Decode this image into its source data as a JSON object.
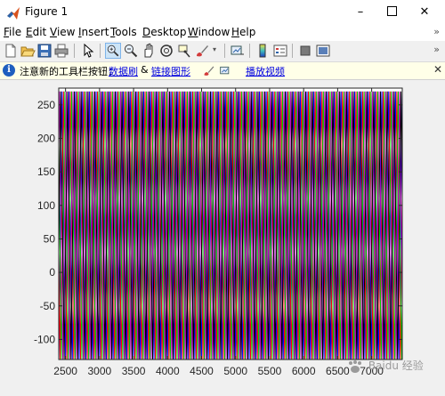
{
  "window": {
    "title": "Figure 1",
    "minimize": "–",
    "close": "✕"
  },
  "menubar": {
    "items": [
      {
        "label": "File",
        "underline": "F",
        "rest": "ile"
      },
      {
        "label": "Edit",
        "underline": "E",
        "rest": "dit"
      },
      {
        "label": "View",
        "underline": "V",
        "rest": "iew"
      },
      {
        "label": "Insert",
        "underline": "I",
        "rest": "nsert"
      },
      {
        "label": "Tools",
        "underline": "T",
        "rest": "ools"
      },
      {
        "label": "Desktop",
        "underline": "D",
        "rest": "esktop"
      },
      {
        "label": "Window",
        "underline": "W",
        "rest": "indow"
      },
      {
        "label": "Help",
        "underline": "H",
        "rest": "elp"
      }
    ],
    "overflow": "»"
  },
  "toolbar": {
    "icons": [
      "new-figure-icon",
      "open-file-icon",
      "save-icon",
      "print-icon",
      "edit-plot-arrow-icon",
      "zoom-in-icon",
      "zoom-out-icon",
      "pan-hand-icon",
      "rotate-3d-icon",
      "data-cursor-icon",
      "brush-icon",
      "link-plot-icon",
      "colorbar-icon",
      "legend-icon",
      "hide-plot-tools-icon",
      "show-plot-tools-icon"
    ],
    "overflow": "»"
  },
  "infobar": {
    "message": "注意新的工具栏按钮：",
    "link1": "数据刷",
    "amp": "&",
    "link2": "链接图形",
    "link3": "播放视频",
    "close": "✕"
  },
  "watermark": {
    "text": "Baidu 经验"
  },
  "chart_data": {
    "type": "line",
    "title": "",
    "xlabel": "",
    "ylabel": "",
    "xlim": [
      2400,
      7450
    ],
    "ylim": [
      -130,
      275
    ],
    "xticks": [
      2500,
      3000,
      3500,
      4000,
      4500,
      5000,
      5500,
      6000,
      6500,
      7000
    ],
    "xtick_labels": [
      "2500",
      "3000",
      "3500",
      "4000",
      "4500",
      "5000",
      "5500",
      "6000",
      "6500",
      "7000"
    ],
    "yticks": [
      -100,
      -50,
      0,
      50,
      100,
      150,
      200,
      250
    ],
    "ytick_labels": [
      "-100",
      "-50",
      "0",
      "50",
      "100",
      "150",
      "200",
      "250"
    ],
    "grid": false,
    "series": [
      {
        "color": "#0000ff",
        "period": 100,
        "phase": 0,
        "amplitude": 200,
        "offset": 70
      },
      {
        "color": "#ff0000",
        "period": 100,
        "phase": 20,
        "amplitude": 200,
        "offset": 70
      },
      {
        "color": "#00cc00",
        "period": 100,
        "phase": 40,
        "amplitude": 200,
        "offset": 70
      },
      {
        "color": "#bf00bf",
        "period": 100,
        "phase": 60,
        "amplitude": 200,
        "offset": 70
      },
      {
        "color": "#000000",
        "period": 100,
        "phase": 80,
        "amplitude": 200,
        "offset": 70
      }
    ]
  }
}
